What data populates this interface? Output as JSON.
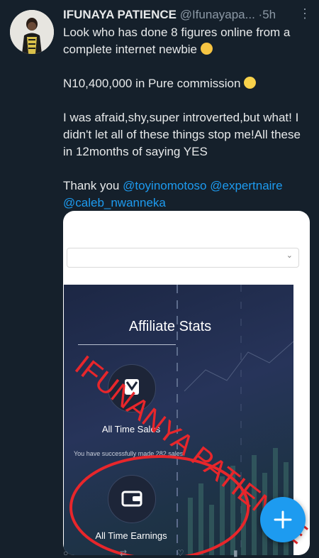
{
  "author": {
    "name": "IFUNAYA PATIENCE",
    "handle": "@Ifunayapa...",
    "separator": "·",
    "time": "5h",
    "more_icon": "more-icon"
  },
  "tweet": {
    "line1": "Look who has done 8 figures online from a complete internet newbie",
    "line1_emoji": "partying-face-emoji",
    "line2": "N10,400,000 in Pure commission",
    "line2_emoji": "weary-face-emoji",
    "line3": "I was afraid,shy,super introverted,but what! I didn't let all of these things stop me!All these in 12months of saying YES",
    "thanks": "Thank you",
    "mentions": [
      "@toyinomotoso",
      "@expertnaire",
      "@caleb_nwanneka"
    ]
  },
  "media": {
    "panel_title": "Affiliate Stats",
    "stat1_label": "All Time Sales",
    "stat1_note": "You have successfully made 282 sales",
    "stat2_label": "All Time Earnings",
    "watermark": "IFUNANYA PATIENCE"
  },
  "colors": {
    "background": "#15202b",
    "accent": "#1d9bf0",
    "watermark": "#e8262b"
  }
}
